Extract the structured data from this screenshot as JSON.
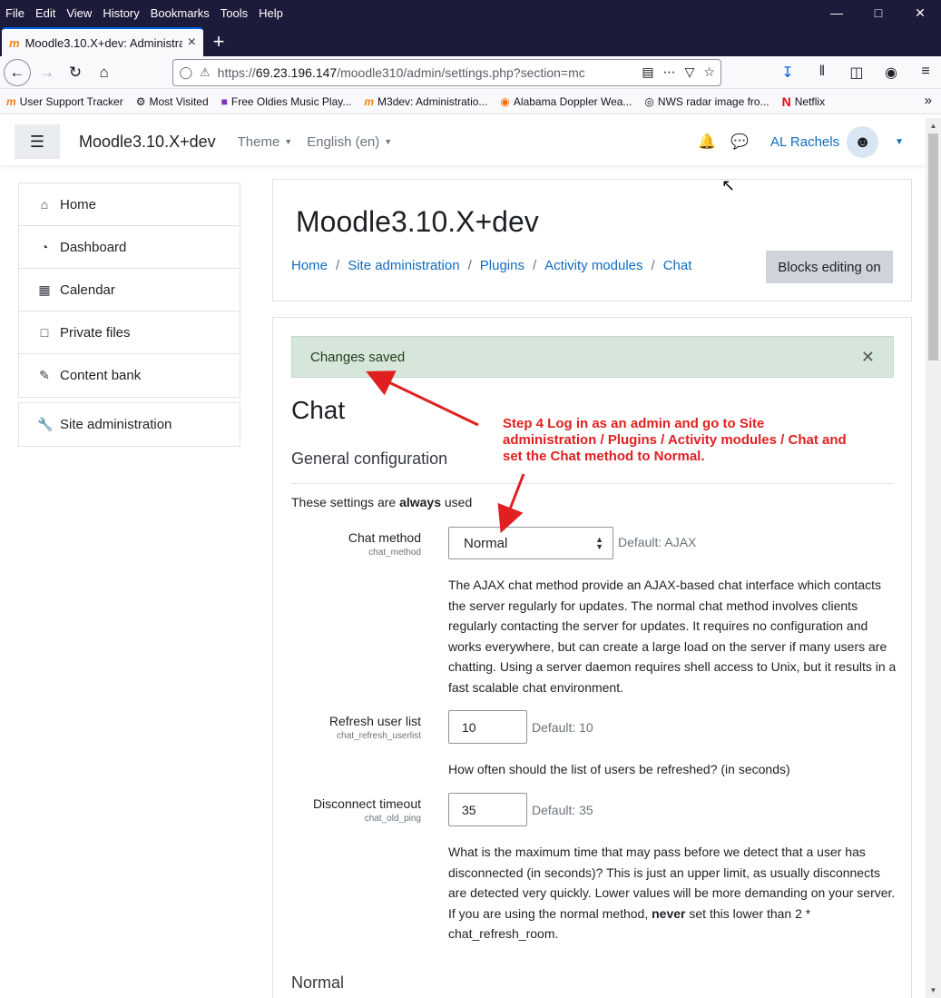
{
  "browser": {
    "menu": [
      "File",
      "Edit",
      "View",
      "History",
      "Bookmarks",
      "Tools",
      "Help"
    ],
    "window_controls": [
      "minimize-icon",
      "maximize-icon",
      "close-icon"
    ],
    "tab_title": "Moodle3.10.X+dev: Administra",
    "url_prefix": "https://",
    "url_host": "69.23.196.147",
    "url_path": "/moodle310/admin/settings.php?section=mc",
    "bookmarks": [
      {
        "label": "User Support Tracker",
        "icon": "moodle-icon"
      },
      {
        "label": "Most Visited",
        "icon": "gear-icon"
      },
      {
        "label": "Free Oldies Music Play...",
        "icon": "radio-icon"
      },
      {
        "label": "M3dev: Administratio...",
        "icon": "moodle-icon"
      },
      {
        "label": "Alabama Doppler Wea...",
        "icon": "weather-icon"
      },
      {
        "label": "NWS radar image fro...",
        "icon": "nws-icon"
      },
      {
        "label": "Netflix",
        "icon": "netflix-icon"
      }
    ]
  },
  "navbar": {
    "brand": "Moodle3.10.X+dev",
    "theme": "Theme",
    "language": "English (en)",
    "user_name": "AL Rachels"
  },
  "sidebar": {
    "items": [
      {
        "label": "Home",
        "icon": "home-icon"
      },
      {
        "label": "Dashboard",
        "icon": "dashboard-icon"
      },
      {
        "label": "Calendar",
        "icon": "calendar-icon"
      },
      {
        "label": "Private files",
        "icon": "file-icon"
      },
      {
        "label": "Content bank",
        "icon": "paintbrush-icon"
      }
    ],
    "admin": {
      "label": "Site administration",
      "icon": "wrench-icon"
    }
  },
  "header": {
    "title": "Moodle3.10.X+dev",
    "breadcrumb": [
      "Home",
      "Site administration",
      "Plugins",
      "Activity modules",
      "Chat"
    ],
    "blocks_button": "Blocks editing on"
  },
  "main": {
    "alert": "Changes saved",
    "heading": "Chat",
    "section": "General configuration",
    "always_prefix": "These settings are ",
    "always_bold": "always",
    "always_suffix": " used",
    "settings": {
      "chat_method": {
        "label": "Chat method",
        "key": "chat_method",
        "value": "Normal",
        "default": "Default: AJAX",
        "description": "The AJAX chat method provide an AJAX-based chat interface which contacts the server regularly for updates. The normal chat method involves clients regularly contacting the server for updates. It requires no configuration and works everywhere, but can create a large load on the server if many users are chatting. Using a server daemon requires shell access to Unix, but it results in a fast scalable chat environment."
      },
      "refresh_userlist": {
        "label": "Refresh user list",
        "key": "chat_refresh_userlist",
        "value": "10",
        "default": "Default: 10",
        "description": "How often should the list of users be refreshed? (in seconds)"
      },
      "disconnect_timeout": {
        "label": "Disconnect timeout",
        "key": "chat_old_ping",
        "value": "35",
        "default": "Default: 35",
        "description_a": "What is the maximum time that may pass before we detect that a user has disconnected (in seconds)? This is just an upper limit, as usually disconnects are detected very quickly. Lower values will be more demanding on your server. If you are using the normal method, ",
        "description_bold": "never",
        "description_b": " set this lower than 2 * chat_refresh_room."
      }
    },
    "next_section": "Normal"
  },
  "annotation": {
    "text": "Step 4 Log in as an admin and go to Site administration / Plugins / Activity modules / Chat and set the Chat method to Normal.",
    "color": "#e02020"
  },
  "colors": {
    "link": "#0f6cbf",
    "alert_bg": "#d7e6da",
    "chrome_dark": "#1c1b3a"
  }
}
